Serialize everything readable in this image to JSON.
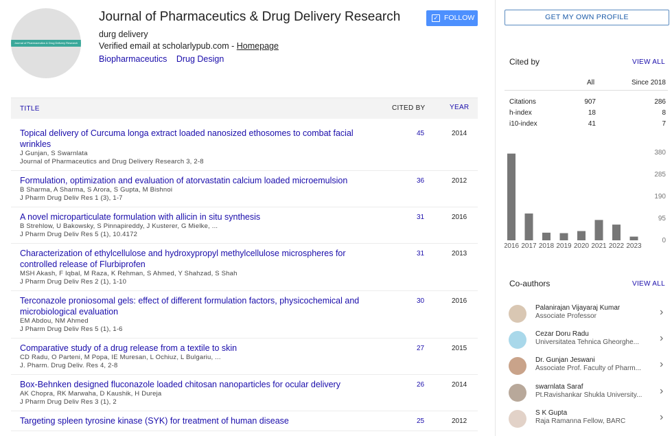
{
  "profile": {
    "avatar_text": "Journal of Pharmaceutics & Drug Delivery Research",
    "name": "Journal of Pharmaceutics & Drug Delivery Research",
    "affiliation": "durg delivery",
    "email_text": "Verified email at scholarlypub.com - ",
    "homepage_label": "Homepage",
    "interests": [
      "Biopharmaceutics",
      "Drug Design"
    ],
    "follow_label": "FOLLOW"
  },
  "table": {
    "col_title": "TITLE",
    "col_cited": "CITED BY",
    "col_year": "YEAR",
    "rows": [
      {
        "title": "Topical delivery of Curcuma longa extract loaded nanosized ethosomes to combat facial wrinkles",
        "authors": "J Gunjan, S Swarnlata",
        "venue": "Journal of Pharmaceutics and Drug Delivery Research 3, 2-8",
        "cited": "45",
        "year": "2014"
      },
      {
        "title": "Formulation, optimization and evaluation of atorvastatin calcium loaded microemulsion",
        "authors": "B Sharma, A Sharma, S Arora, S Gupta, M Bishnoi",
        "venue": "J Pharm Drug Deliv Res 1 (3), 1-7",
        "cited": "36",
        "year": "2012"
      },
      {
        "title": "A novel microparticulate formulation with allicin in situ synthesis",
        "authors": "B Strehlow, U Bakowsky, S Pinnapireddy, J Kusterer, G Mielke, ...",
        "venue": "J Pharm Drug Deliv Res 5 (1), 10.4172",
        "cited": "31",
        "year": "2016"
      },
      {
        "title": "Characterization of ethylcellulose and hydroxypropyl methylcellulose microspheres for controlled release of Flurbiprofen",
        "authors": "MSH Akash, F Iqbal, M Raza, K Rehman, S Ahmed, Y Shahzad, S Shah",
        "venue": "J Pharm Drug Deliv Res 2 (1), 1-10",
        "cited": "31",
        "year": "2013"
      },
      {
        "title": "Terconazole proniosomal gels: effect of different formulation factors, physicochemical and microbiological evaluation",
        "authors": "EM Abdou, NM Ahmed",
        "venue": "J Pharm Drug Deliv Res 5 (1), 1-6",
        "cited": "30",
        "year": "2016"
      },
      {
        "title": "Comparative study of a drug release from a textile to skin",
        "authors": "CD Radu, O Parteni, M Popa, IE Muresan, L Ochiuz, L Bulgariu, ...",
        "venue": "J. Pharm. Drug Deliv. Res 4, 2-8",
        "cited": "27",
        "year": "2015"
      },
      {
        "title": "Box-Behnken designed fluconazole loaded chitosan nanoparticles for ocular delivery",
        "authors": "AK Chopra, RK Marwaha, D Kaushik, H Dureja",
        "venue": "J Pharm Drug Deliv Res 3 (1), 2",
        "cited": "26",
        "year": "2014"
      },
      {
        "title": "Targeting spleen tyrosine kinase (SYK) for treatment of human disease",
        "authors": "",
        "venue": "",
        "cited": "25",
        "year": "2012"
      }
    ]
  },
  "sidebar": {
    "own_profile_label": "GET MY OWN PROFILE",
    "cited_by_title": "Cited by",
    "view_all_label": "VIEW ALL",
    "col_all": "All",
    "col_since": "Since 2018",
    "metrics": [
      {
        "label": "Citations",
        "all": "907",
        "since": "286"
      },
      {
        "label": "h-index",
        "all": "18",
        "since": "8"
      },
      {
        "label": "i10-index",
        "all": "41",
        "since": "7"
      }
    ],
    "coauthors_title": "Co-authors",
    "coauthors": [
      {
        "name": "Palanirajan Vijayaraj Kumar",
        "affiliation": "Associate Professor"
      },
      {
        "name": "Cezar Doru Radu",
        "affiliation": "Universitatea Tehnica Gheorghe..."
      },
      {
        "name": "Dr. Gunjan Jeswani",
        "affiliation": "Associate Prof. Faculty of Pharm..."
      },
      {
        "name": "swarnlata Saraf",
        "affiliation": "Pt.Ravishankar Shukla University..."
      },
      {
        "name": "S K Gupta",
        "affiliation": "Raja Ramanna Fellow, BARC"
      }
    ]
  },
  "chart_data": {
    "type": "bar",
    "categories": [
      "2016",
      "2017",
      "2018",
      "2019",
      "2020",
      "2021",
      "2022",
      "2023"
    ],
    "values": [
      375,
      116,
      33,
      31,
      40,
      88,
      68,
      16
    ],
    "yticks": [
      "380",
      "285",
      "190",
      "95",
      "0"
    ],
    "ylim": [
      0,
      380
    ],
    "bar_color": "#777777"
  }
}
